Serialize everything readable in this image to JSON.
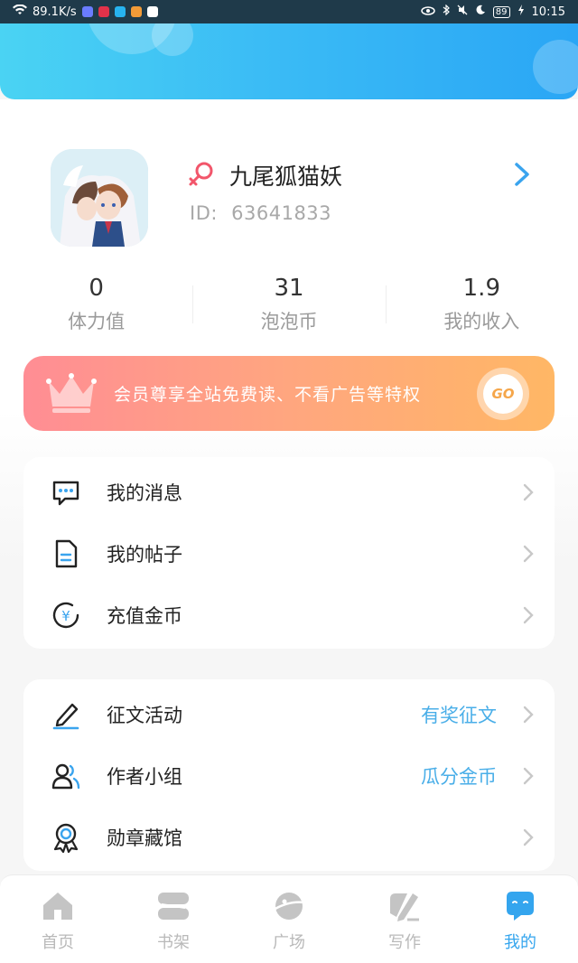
{
  "status_bar": {
    "speed": "89.1K/s",
    "battery": "89",
    "time": "10:15"
  },
  "profile": {
    "nickname": "九尾狐猫妖",
    "id_label": "ID:",
    "id_value": "63641833",
    "gender_icon": "female-icon"
  },
  "stats": [
    {
      "value": "0",
      "label": "体力值"
    },
    {
      "value": "31",
      "label": "泡泡币"
    },
    {
      "value": "1.9",
      "label": "我的收入"
    }
  ],
  "vip_banner": {
    "text": "会员尊享全站免费读、不看广告等特权",
    "go_label": "GO"
  },
  "menu_group_1": [
    {
      "label": "我的消息",
      "icon": "message-icon"
    },
    {
      "label": "我的帖子",
      "icon": "document-icon"
    },
    {
      "label": "充值金币",
      "icon": "coin-icon"
    }
  ],
  "menu_group_2": [
    {
      "label": "征文活动",
      "extra": "有奖征文",
      "icon": "pen-icon"
    },
    {
      "label": "作者小组",
      "extra": "瓜分金币",
      "icon": "group-icon"
    },
    {
      "label": "勋章藏馆",
      "extra": "",
      "icon": "medal-icon"
    }
  ],
  "tabbar": [
    {
      "label": "首页",
      "icon": "home-icon"
    },
    {
      "label": "书架",
      "icon": "bookshelf-icon"
    },
    {
      "label": "广场",
      "icon": "planet-icon"
    },
    {
      "label": "写作",
      "icon": "write-icon"
    },
    {
      "label": "我的",
      "icon": "profile-chat-icon",
      "active": true
    }
  ],
  "colors": {
    "accent": "#34a5ee",
    "header_start": "#4ad3f3",
    "header_end": "#2aa6f5",
    "vip_start": "#ff8d94",
    "vip_end": "#ffb765"
  }
}
